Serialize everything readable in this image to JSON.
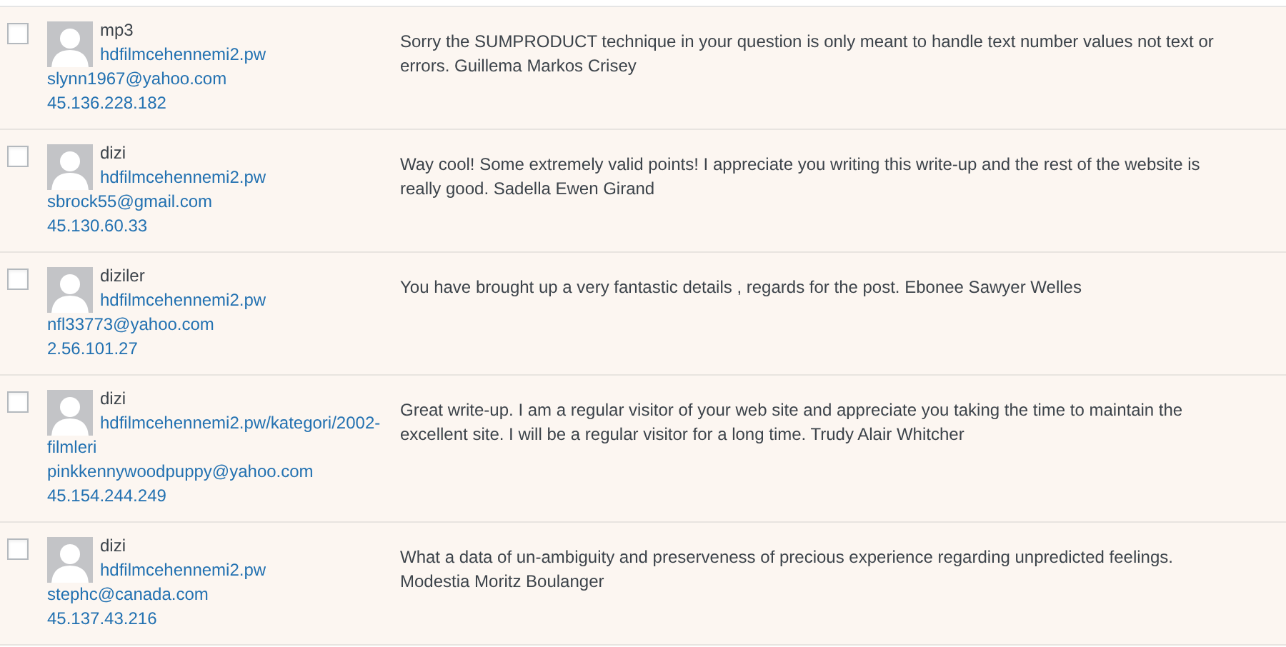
{
  "comments": [
    {
      "checked": false,
      "author": "mp3",
      "url": "hdfilmcehennemi2.pw",
      "email": "slynn1967@yahoo.com",
      "ip": "45.136.228.182",
      "text": "Sorry the SUMPRODUCT technique in your question is only meant to handle text number values not text or errors. Guillema Markos Crisey"
    },
    {
      "checked": false,
      "author": "dizi",
      "url": "hdfilmcehennemi2.pw",
      "email": "sbrock55@gmail.com",
      "ip": "45.130.60.33",
      "text": "Way cool! Some extremely valid points! I appreciate you writing this write-up and the rest of the website is really good. Sadella Ewen Girand"
    },
    {
      "checked": false,
      "author": "diziler",
      "url": "hdfilmcehennemi2.pw",
      "email": "nfl33773@yahoo.com",
      "ip": "2.56.101.27",
      "text": "You have brought up a very fantastic details , regards for the post. Ebonee Sawyer Welles"
    },
    {
      "checked": false,
      "author": "dizi",
      "url": "hdfilmcehennemi2.pw/kategori/2002-filmleri",
      "email": "pinkkennywoodpuppy@yahoo.com",
      "ip": "45.154.244.249",
      "text": "Great write-up. I am a regular visitor of your web site and appreciate you taking the time to maintain the excellent site. I will be a regular visitor for a long time. Trudy Alair Whitcher"
    },
    {
      "checked": false,
      "author": "dizi",
      "url": "hdfilmcehennemi2.pw",
      "email": "stephc@canada.com",
      "ip": "45.137.43.216",
      "text": "What a data of un-ambiguity and preserveness of precious experience regarding unpredicted feelings. Modestia Moritz Boulanger"
    }
  ]
}
